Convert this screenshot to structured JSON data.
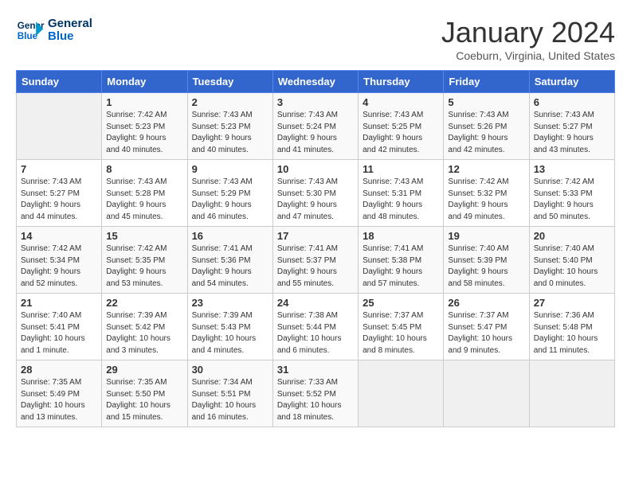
{
  "header": {
    "logo_line1": "General",
    "logo_line2": "Blue",
    "title": "January 2024",
    "subtitle": "Coeburn, Virginia, United States"
  },
  "weekdays": [
    "Sunday",
    "Monday",
    "Tuesday",
    "Wednesday",
    "Thursday",
    "Friday",
    "Saturday"
  ],
  "weeks": [
    [
      {
        "day": "",
        "info": ""
      },
      {
        "day": "1",
        "info": "Sunrise: 7:42 AM\nSunset: 5:23 PM\nDaylight: 9 hours\nand 40 minutes."
      },
      {
        "day": "2",
        "info": "Sunrise: 7:43 AM\nSunset: 5:23 PM\nDaylight: 9 hours\nand 40 minutes."
      },
      {
        "day": "3",
        "info": "Sunrise: 7:43 AM\nSunset: 5:24 PM\nDaylight: 9 hours\nand 41 minutes."
      },
      {
        "day": "4",
        "info": "Sunrise: 7:43 AM\nSunset: 5:25 PM\nDaylight: 9 hours\nand 42 minutes."
      },
      {
        "day": "5",
        "info": "Sunrise: 7:43 AM\nSunset: 5:26 PM\nDaylight: 9 hours\nand 42 minutes."
      },
      {
        "day": "6",
        "info": "Sunrise: 7:43 AM\nSunset: 5:27 PM\nDaylight: 9 hours\nand 43 minutes."
      }
    ],
    [
      {
        "day": "7",
        "info": "Sunrise: 7:43 AM\nSunset: 5:27 PM\nDaylight: 9 hours\nand 44 minutes."
      },
      {
        "day": "8",
        "info": "Sunrise: 7:43 AM\nSunset: 5:28 PM\nDaylight: 9 hours\nand 45 minutes."
      },
      {
        "day": "9",
        "info": "Sunrise: 7:43 AM\nSunset: 5:29 PM\nDaylight: 9 hours\nand 46 minutes."
      },
      {
        "day": "10",
        "info": "Sunrise: 7:43 AM\nSunset: 5:30 PM\nDaylight: 9 hours\nand 47 minutes."
      },
      {
        "day": "11",
        "info": "Sunrise: 7:43 AM\nSunset: 5:31 PM\nDaylight: 9 hours\nand 48 minutes."
      },
      {
        "day": "12",
        "info": "Sunrise: 7:42 AM\nSunset: 5:32 PM\nDaylight: 9 hours\nand 49 minutes."
      },
      {
        "day": "13",
        "info": "Sunrise: 7:42 AM\nSunset: 5:33 PM\nDaylight: 9 hours\nand 50 minutes."
      }
    ],
    [
      {
        "day": "14",
        "info": "Sunrise: 7:42 AM\nSunset: 5:34 PM\nDaylight: 9 hours\nand 52 minutes."
      },
      {
        "day": "15",
        "info": "Sunrise: 7:42 AM\nSunset: 5:35 PM\nDaylight: 9 hours\nand 53 minutes."
      },
      {
        "day": "16",
        "info": "Sunrise: 7:41 AM\nSunset: 5:36 PM\nDaylight: 9 hours\nand 54 minutes."
      },
      {
        "day": "17",
        "info": "Sunrise: 7:41 AM\nSunset: 5:37 PM\nDaylight: 9 hours\nand 55 minutes."
      },
      {
        "day": "18",
        "info": "Sunrise: 7:41 AM\nSunset: 5:38 PM\nDaylight: 9 hours\nand 57 minutes."
      },
      {
        "day": "19",
        "info": "Sunrise: 7:40 AM\nSunset: 5:39 PM\nDaylight: 9 hours\nand 58 minutes."
      },
      {
        "day": "20",
        "info": "Sunrise: 7:40 AM\nSunset: 5:40 PM\nDaylight: 10 hours\nand 0 minutes."
      }
    ],
    [
      {
        "day": "21",
        "info": "Sunrise: 7:40 AM\nSunset: 5:41 PM\nDaylight: 10 hours\nand 1 minute."
      },
      {
        "day": "22",
        "info": "Sunrise: 7:39 AM\nSunset: 5:42 PM\nDaylight: 10 hours\nand 3 minutes."
      },
      {
        "day": "23",
        "info": "Sunrise: 7:39 AM\nSunset: 5:43 PM\nDaylight: 10 hours\nand 4 minutes."
      },
      {
        "day": "24",
        "info": "Sunrise: 7:38 AM\nSunset: 5:44 PM\nDaylight: 10 hours\nand 6 minutes."
      },
      {
        "day": "25",
        "info": "Sunrise: 7:37 AM\nSunset: 5:45 PM\nDaylight: 10 hours\nand 8 minutes."
      },
      {
        "day": "26",
        "info": "Sunrise: 7:37 AM\nSunset: 5:47 PM\nDaylight: 10 hours\nand 9 minutes."
      },
      {
        "day": "27",
        "info": "Sunrise: 7:36 AM\nSunset: 5:48 PM\nDaylight: 10 hours\nand 11 minutes."
      }
    ],
    [
      {
        "day": "28",
        "info": "Sunrise: 7:35 AM\nSunset: 5:49 PM\nDaylight: 10 hours\nand 13 minutes."
      },
      {
        "day": "29",
        "info": "Sunrise: 7:35 AM\nSunset: 5:50 PM\nDaylight: 10 hours\nand 15 minutes."
      },
      {
        "day": "30",
        "info": "Sunrise: 7:34 AM\nSunset: 5:51 PM\nDaylight: 10 hours\nand 16 minutes."
      },
      {
        "day": "31",
        "info": "Sunrise: 7:33 AM\nSunset: 5:52 PM\nDaylight: 10 hours\nand 18 minutes."
      },
      {
        "day": "",
        "info": ""
      },
      {
        "day": "",
        "info": ""
      },
      {
        "day": "",
        "info": ""
      }
    ]
  ]
}
